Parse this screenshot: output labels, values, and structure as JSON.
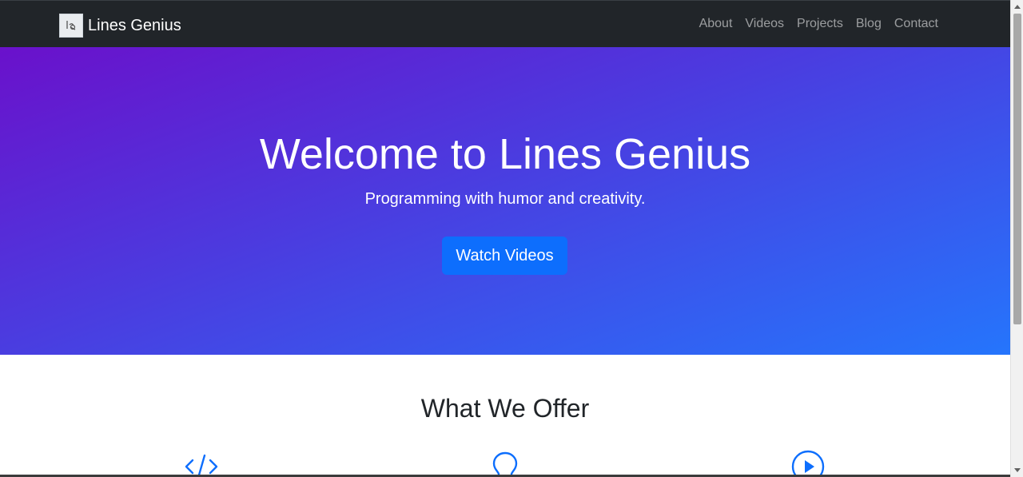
{
  "navbar": {
    "brand_name": "Lines Genius",
    "links": [
      {
        "label": "About"
      },
      {
        "label": "Videos"
      },
      {
        "label": "Projects"
      },
      {
        "label": "Blog"
      },
      {
        "label": "Contact"
      }
    ]
  },
  "hero": {
    "title": "Welcome to Lines Genius",
    "subtitle": "Programming with humor and creativity.",
    "button_label": "Watch Videos",
    "gradient_start": "#6a11cb",
    "gradient_end": "#2575fc"
  },
  "offer": {
    "title": "What We Offer",
    "icons": [
      "code-icon",
      "lightbulb-icon",
      "play-circle-icon"
    ],
    "icon_color": "#0d6efd"
  },
  "colors": {
    "navbar_bg": "#212529",
    "button_bg": "#0d6efd"
  }
}
